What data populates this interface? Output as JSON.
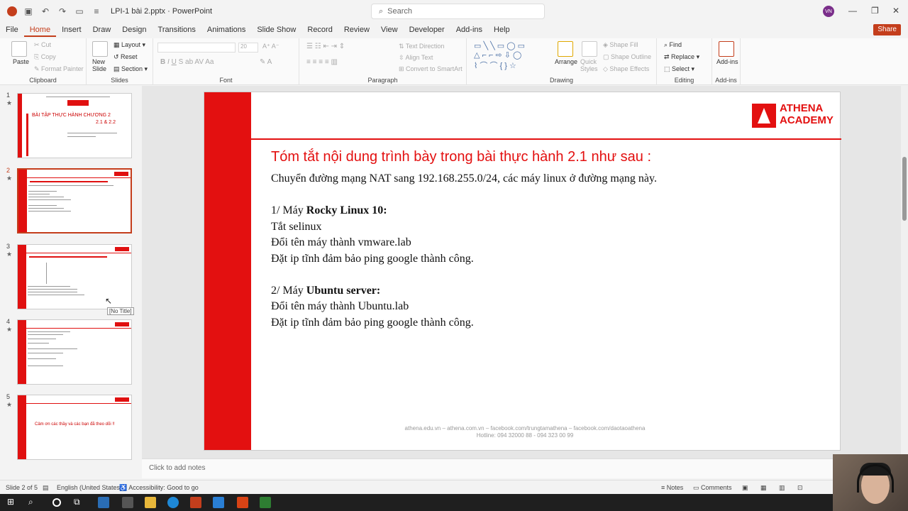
{
  "window": {
    "title": "LPI-1 bài 2.pptx  ·  PowerPoint",
    "search_placeholder": "Search",
    "avatar_initials": "VN"
  },
  "menu": {
    "tabs": [
      "File",
      "Home",
      "Insert",
      "Draw",
      "Design",
      "Transitions",
      "Animations",
      "Slide Show",
      "Record",
      "Review",
      "View",
      "Developer",
      "Add-ins",
      "Help"
    ],
    "share_label": "Share"
  },
  "ribbon": {
    "clipboard": {
      "label": "Clipboard",
      "paste": "Paste",
      "cut": "Cut",
      "copy": "Copy",
      "format_painter": "Format Painter"
    },
    "slides": {
      "label": "Slides",
      "new_slide": "New Slide",
      "layout": "Layout",
      "reset": "Reset",
      "section": "Section"
    },
    "font": {
      "label": "Font",
      "size": "20"
    },
    "paragraph": {
      "label": "Paragraph",
      "text_direction": "Text Direction",
      "align_text": "Align Text",
      "smartart": "Convert to SmartArt"
    },
    "drawing": {
      "label": "Drawing",
      "arrange": "Arrange",
      "quick_styles": "Quick Styles",
      "shape_fill": "Shape Fill",
      "shape_outline": "Shape Outline",
      "shape_effects": "Shape Effects"
    },
    "editing": {
      "label": "Editing",
      "find": "Find",
      "replace": "Replace",
      "select": "Select"
    },
    "addins": {
      "label": "Add-ins",
      "button": "Add-ins"
    }
  },
  "thumbnails": {
    "numbers": [
      "1",
      "2",
      "3",
      "4",
      "5"
    ],
    "slide1_title": "BÀI TẬP THỰC HÀNH CHƯƠNG 2",
    "slide1_sub": "2.1 & 2.2",
    "slide5_text": "Cảm ơn các thầy và các bạn đã theo dõi !!",
    "tooltip": "[No Title]"
  },
  "slide": {
    "logo_line1": "ATHENA",
    "logo_line2": "ACADEMY",
    "title": "Tóm tắt nội dung trình bày trong bài thực hành 2.1 như sau :",
    "intro": "Chuyển đường mạng NAT sang 192.168.255.0/24, các máy linux ở đường mạng này.",
    "section1_prefix": "1/ Máy ",
    "section1_bold": "Rocky Linux 10:",
    "section1_items": [
      "Tắt selinux",
      "Đổi tên máy  thành vmware.lab",
      "Đặt ip tĩnh đảm bảo ping google thành công."
    ],
    "section2_prefix": "2/ Máy ",
    "section2_bold": "Ubuntu server:",
    "section2_items": [
      "Đổi tên máy  thành Ubuntu.lab",
      "Đặt ip tĩnh đảm bảo ping google thành công."
    ],
    "footer_line1": "athena.edu.vn – athena.com.vn –  facebook.com/trungtamathena – facebook.com/daotaoathena",
    "footer_line2": "Hotline: 094 32000 88 - 094 323 00 99"
  },
  "notes": {
    "placeholder": "Click to add notes"
  },
  "status": {
    "slide_counter": "Slide 2 of 5",
    "language": "English (United States)",
    "accessibility": "Accessibility: Good to go",
    "notes_btn": "Notes",
    "comments_btn": "Comments"
  },
  "colors": {
    "accent": "#c43e1c",
    "slide_red": "#e31010"
  }
}
